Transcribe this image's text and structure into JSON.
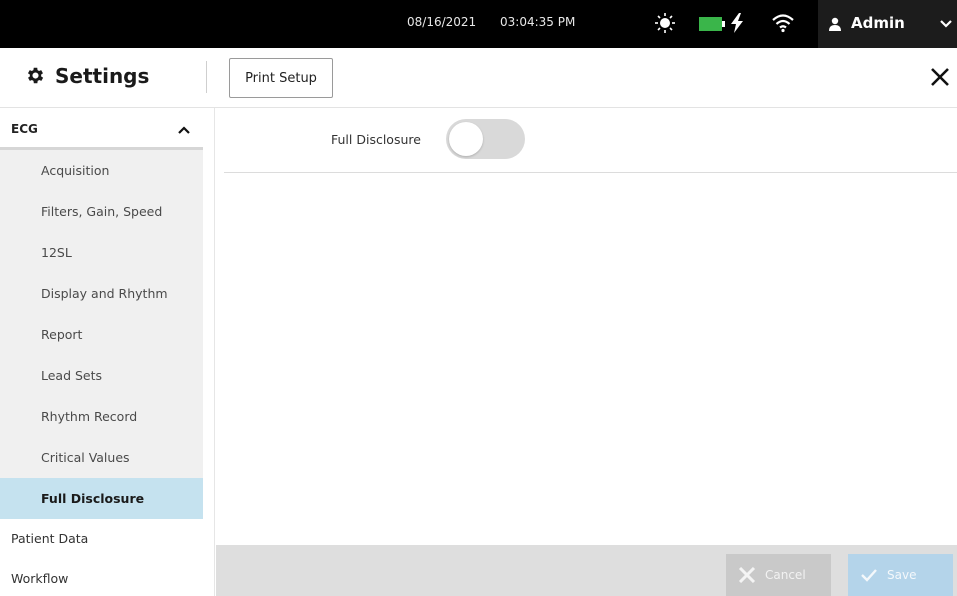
{
  "statusbar": {
    "date": "08/16/2021",
    "time": "03:04:35 PM",
    "user_label": "Admin",
    "battery_color": "#3ab54a"
  },
  "header": {
    "title": "Settings",
    "print_setup_label": "Print Setup"
  },
  "sidebar": {
    "section_label": "ECG",
    "sub_items": [
      {
        "label": "Acquisition"
      },
      {
        "label": "Filters, Gain, Speed"
      },
      {
        "label": "12SL"
      },
      {
        "label": "Display and Rhythm"
      },
      {
        "label": "Report"
      },
      {
        "label": "Lead Sets"
      },
      {
        "label": "Rhythm Record"
      },
      {
        "label": "Critical Values"
      },
      {
        "label": "Full Disclosure"
      }
    ],
    "active_item": "Full Disclosure",
    "top_items": [
      {
        "label": "Patient Data"
      },
      {
        "label": "Workflow"
      }
    ]
  },
  "main": {
    "full_disclosure_label": "Full Disclosure",
    "full_disclosure_enabled": false
  },
  "footer": {
    "cancel_label": "Cancel",
    "save_label": "Save"
  },
  "colors": {
    "active_item_bg": "#c5e2ef",
    "save_button_bg": "#b4d4ea"
  }
}
